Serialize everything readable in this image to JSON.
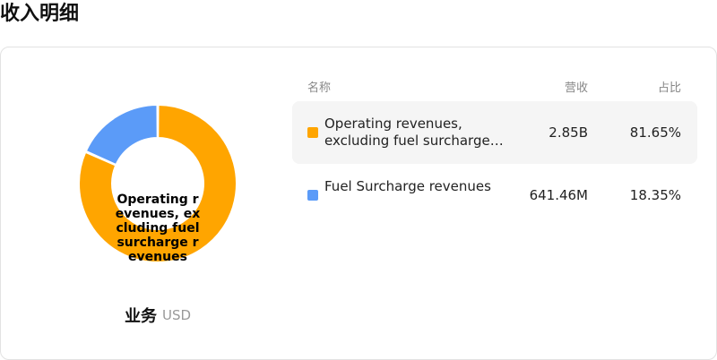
{
  "page": {
    "title": "收入明细"
  },
  "table": {
    "headers": {
      "name": "名称",
      "revenue": "营收",
      "share": "占比"
    },
    "rows": [
      {
        "name": "Operating revenues, excluding fuel surcharge revenues",
        "revenue": "2.85B",
        "share": "81.65%",
        "color": "#FFA500"
      },
      {
        "name": "Fuel Surcharge revenues",
        "revenue": "641.46M",
        "share": "18.35%",
        "color": "#5B9BF8"
      }
    ]
  },
  "donut": {
    "center_label": "Operating revenues, excluding fuel surcharge revenues"
  },
  "footer": {
    "segment_label": "业务",
    "currency": "USD"
  },
  "chart_data": {
    "type": "pie",
    "categories": [
      "Operating revenues, excluding fuel surcharge revenues",
      "Fuel Surcharge revenues"
    ],
    "values": [
      81.65,
      18.35
    ],
    "colors": [
      "#FFA500",
      "#5B9BF8"
    ]
  }
}
